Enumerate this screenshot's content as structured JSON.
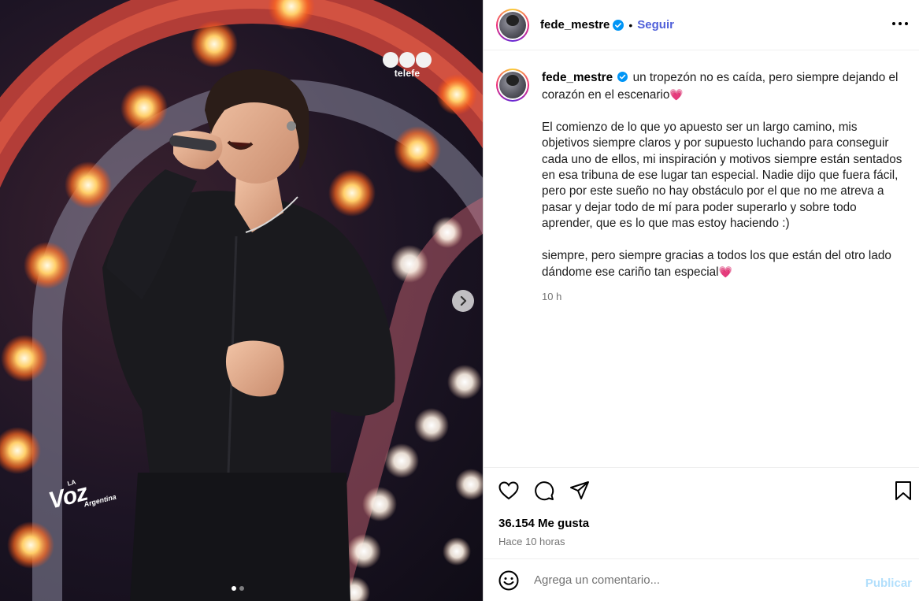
{
  "photo": {
    "broadcaster_logo": "telefe",
    "show_logo": {
      "la": "LA",
      "voz": "Voz",
      "country": "Argentina"
    },
    "next_icon": "chevron-right-icon",
    "carousel": {
      "count": 2,
      "active": 1
    }
  },
  "header": {
    "username": "fede_mestre",
    "verified_icon": "verified-badge-icon",
    "separator": "•",
    "follow_label": "Seguir",
    "more_icon": "more-options-icon"
  },
  "caption": {
    "username": "fede_mestre",
    "line1": "un tropezón no es caída, pero siempre dejando el corazón en el escenario",
    "paragraph2": "El comienzo de lo que yo apuesto ser un largo camino, mis objetivos siempre claros y por supuesto luchando para conseguir cada uno de ellos, mi inspiración y motivos siempre están sentados en esa tribuna de ese lugar tan especial. Nadie dijo que fuera fácil, pero por este sueño no hay obstáculo por el que no me atreva a pasar y dejar todo de mí para poder superarlo y sobre todo aprender, que es lo que mas estoy haciendo :)",
    "paragraph3": "siempre, pero siempre gracias a todos los que están del otro lado dándome ese cariño tan especial",
    "heart": "💗",
    "time": "10 h"
  },
  "actions": {
    "like_icon": "heart-icon",
    "comment_icon": "comment-icon",
    "share_icon": "share-icon",
    "save_icon": "bookmark-icon",
    "likes_text": "36.154 Me gusta",
    "posted_ago": "Hace 10 horas"
  },
  "comment": {
    "emoji_icon": "emoji-icon",
    "placeholder": "Agrega un comentario...",
    "publish_label": "Publicar"
  },
  "colors": {
    "link_blue": "#4f5fd9",
    "publish_disabled": "#b2dffc",
    "verified_blue": "#0095f6",
    "secondary_text": "#737373"
  }
}
